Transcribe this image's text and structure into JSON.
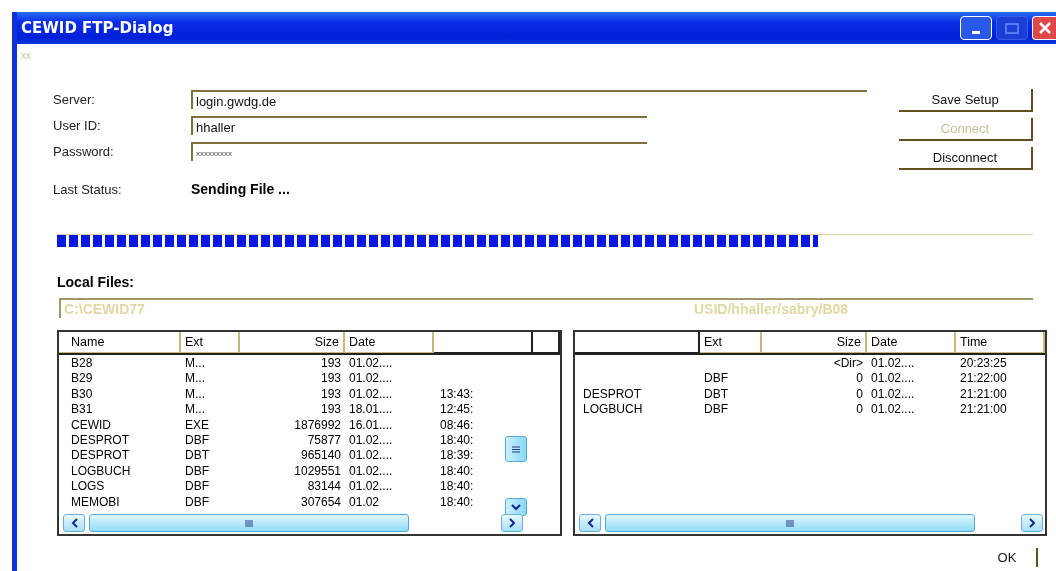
{
  "window": {
    "title": "CEWID FTP-Dialog",
    "subtitle": "xx"
  },
  "form": {
    "fields": [
      {
        "label": "Server:",
        "value": "login.gwdg.de",
        "kind": "long"
      },
      {
        "label": "User ID:",
        "value": "hhaller",
        "kind": "short"
      },
      {
        "label": "Password:",
        "value": "xxxxxxxxx",
        "kind": "password"
      }
    ],
    "status_label": "Last Status:",
    "status": "Sending File ..."
  },
  "buttons": [
    {
      "label": "Save Setup",
      "disabled": false
    },
    {
      "label": "Connect",
      "disabled": true
    },
    {
      "label": "Disconnect",
      "disabled": false
    }
  ],
  "progress": {
    "level": 0.78
  },
  "local_files_label": "Local Files:",
  "local": {
    "path": "C:\\CEWID77",
    "columns": [
      "Name",
      "Ext",
      "Size",
      "Date"
    ],
    "rows": [
      {
        "name": "B28",
        "ext": "M...",
        "size": "193",
        "date": "01.02...."
      },
      {
        "name": "B29",
        "ext": "M...",
        "size": "193",
        "date": "01.02...."
      },
      {
        "name": "B30",
        "ext": "M...",
        "size": "193",
        "date": "01.02....",
        "time": "13:43:"
      },
      {
        "name": "B31",
        "ext": "M...",
        "size": "193",
        "date": "18.01....",
        "time": "12:45:"
      },
      {
        "name": "CEWID",
        "ext": "EXE",
        "size": "1876992",
        "date": "16.01....",
        "time": "08:46:"
      },
      {
        "name": "DESPROT",
        "ext": "DBF",
        "size": "75877",
        "date": "01.02....",
        "time": "18:40:"
      },
      {
        "name": "DESPROT",
        "ext": "DBT",
        "size": "965140",
        "date": "01.02....",
        "time": "18:39:"
      },
      {
        "name": "LOGBUCH",
        "ext": "DBF",
        "size": "1029551",
        "date": "01.02....",
        "time": "18:40:"
      },
      {
        "name": "LOGS",
        "ext": "DBF",
        "size": "83144",
        "date": "01.02....",
        "time": "18:40:"
      },
      {
        "name": "MEMOBI",
        "ext": "DBF",
        "size": "307654",
        "date": "01.02",
        "time": "18:40:"
      }
    ]
  },
  "remote": {
    "path": "USID/hhaller/sabry/B08",
    "columns": [
      "Ext",
      "Size",
      "Date",
      "Time"
    ],
    "rows": [
      {
        "size": "<Dir>",
        "date": "01.02....",
        "time": "20:23:25"
      },
      {
        "ext": "DBF",
        "size": "0",
        "date": "01.02....",
        "time": "21:22:00"
      },
      {
        "name": "DESPROT",
        "ext": "DBT",
        "size": "0",
        "date": "01.02....",
        "time": "21:21:00"
      },
      {
        "name": "LOGBUCH",
        "ext": "DBF",
        "size": "0",
        "date": "01.02....",
        "time": "21:21:00"
      }
    ]
  },
  "ok_button": "OK"
}
